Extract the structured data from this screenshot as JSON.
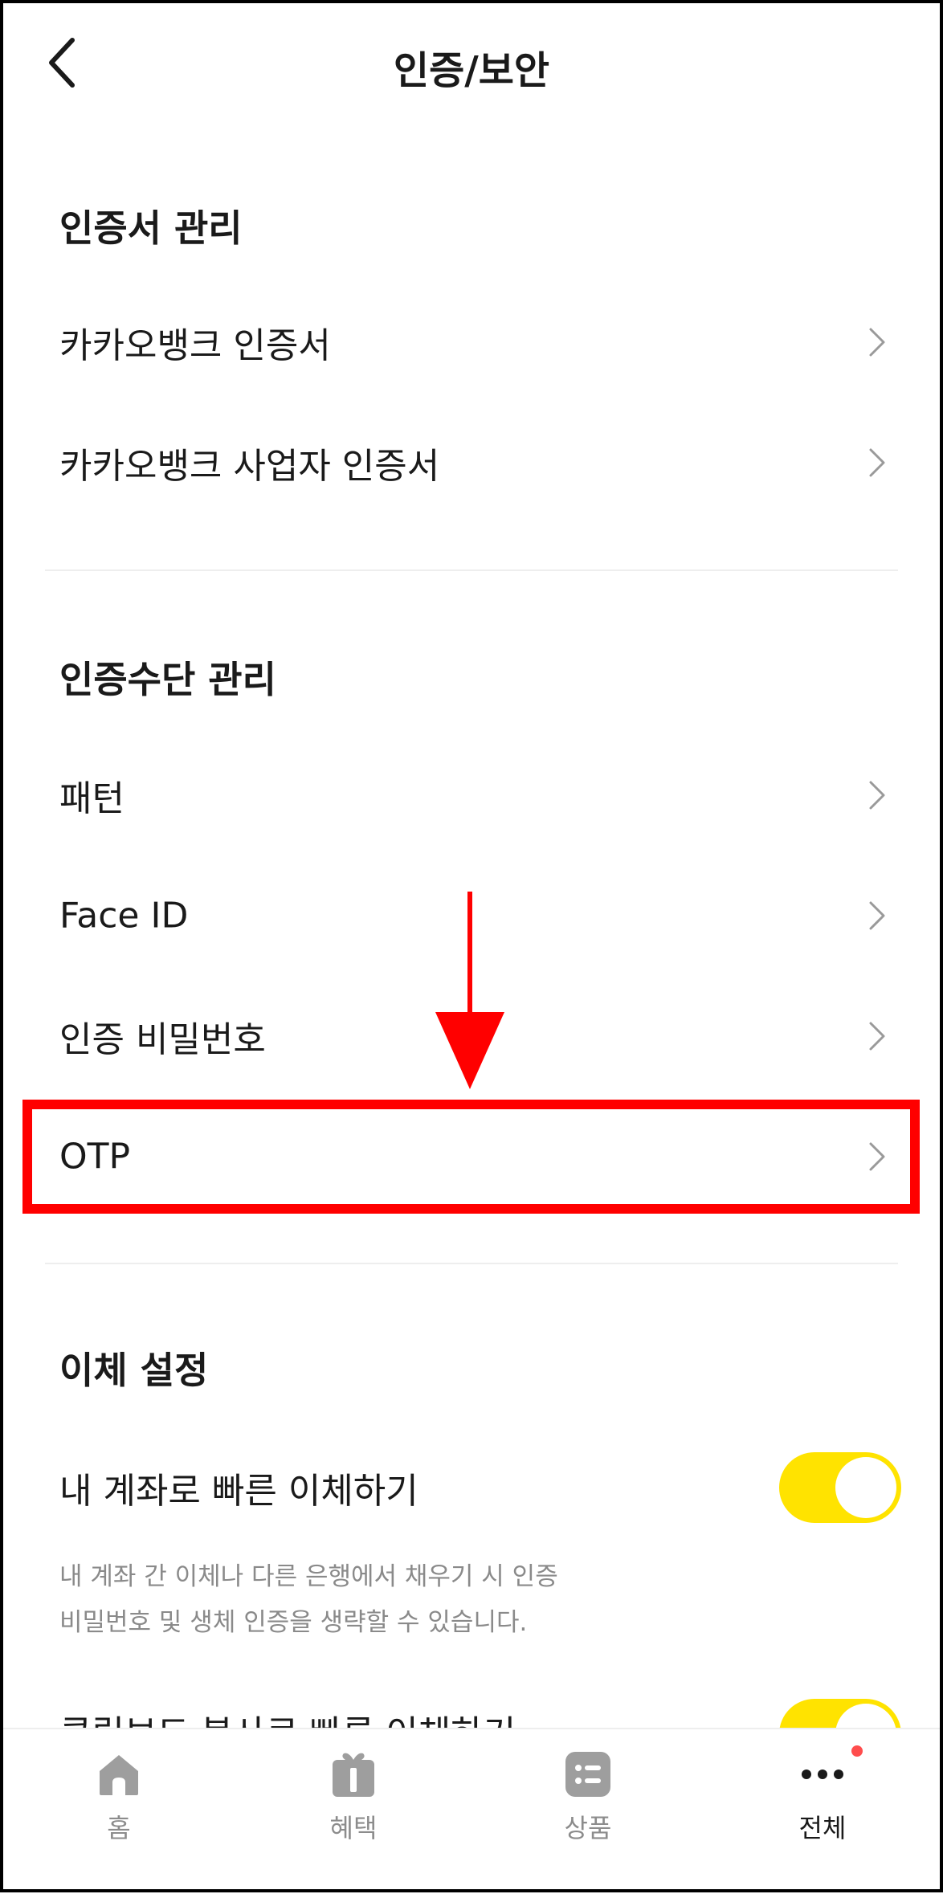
{
  "header": {
    "title": "인증/보안",
    "back_icon": "chevron-left-icon"
  },
  "sections": {
    "certificate": {
      "title": "인증서 관리",
      "items": [
        {
          "label": "카카오뱅크 인증서"
        },
        {
          "label": "카카오뱅크 사업자 인증서"
        }
      ]
    },
    "auth_method": {
      "title": "인증수단 관리",
      "items": [
        {
          "label": "패턴"
        },
        {
          "label": "Face ID"
        },
        {
          "label": "인증 비밀번호"
        },
        {
          "label": "OTP"
        }
      ]
    },
    "transfer": {
      "title": "이체 설정",
      "quick_transfer": {
        "label": "내 계좌로 빠른 이체하기",
        "enabled": true,
        "description_line1": "내 계좌 간 이체나 다른 은행에서 채우기 시 인증",
        "description_line2": "비밀번호 및 생체 인증을 생략할 수 있습니다."
      },
      "clipboard_transfer": {
        "label": "클립보드 복사로 빠른 이체하기",
        "enabled": true
      }
    }
  },
  "bottom_nav": {
    "items": [
      {
        "label": "홈",
        "icon": "home-icon"
      },
      {
        "label": "혜택",
        "icon": "gift-icon"
      },
      {
        "label": "상품",
        "icon": "list-icon"
      },
      {
        "label": "전체",
        "icon": "more-icon",
        "active": true,
        "badge": true
      }
    ]
  },
  "colors": {
    "accent_yellow": "#FFE300",
    "annotation_red": "#FF0000",
    "badge_red": "#FF4D4D"
  }
}
